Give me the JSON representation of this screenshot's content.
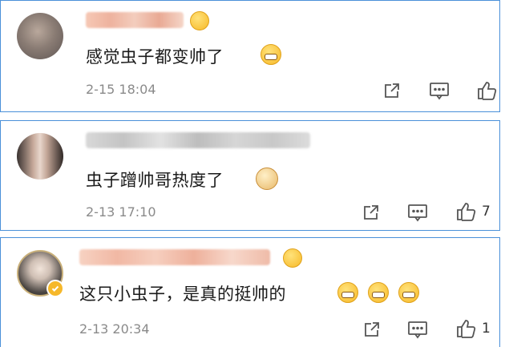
{
  "comments": [
    {
      "text": "感觉虫子都变帅了",
      "time": "2-15 18:04",
      "like_count": ""
    },
    {
      "text": "虫子蹭帅哥热度了",
      "time": "2-13 17:10",
      "like_count": "7"
    },
    {
      "text": "这只小虫子，是真的挺帅的",
      "time": "2-13 20:34",
      "like_count": "1"
    }
  ],
  "icons": {
    "share": "share-icon",
    "comment": "comment-icon",
    "like": "thumbs-up-icon",
    "badge": "badge-emoji-icon"
  },
  "colors": {
    "border": "#4a90d9",
    "text": "#1a1a1a",
    "meta": "#8a8a8a",
    "verify": "#f6b82a"
  }
}
